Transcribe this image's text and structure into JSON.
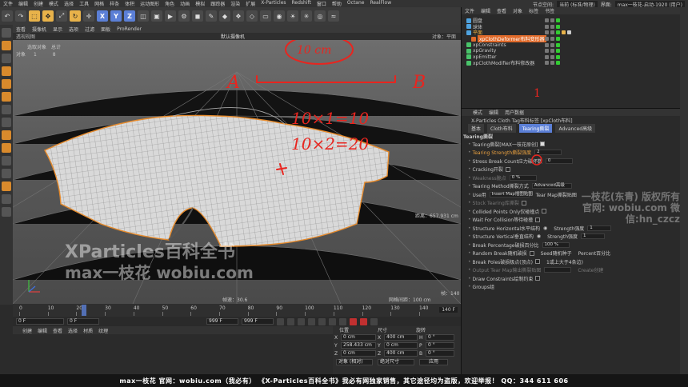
{
  "menubar": {
    "items": [
      "文件",
      "编辑",
      "创建",
      "模式",
      "选择",
      "工具",
      "网格",
      "样条",
      "体积",
      "运动图形",
      "角色",
      "动画",
      "模拟",
      "跟踪器",
      "渲染",
      "扩展",
      "X-Particles",
      "Redshift",
      "窗口",
      "帮助",
      "Octane",
      "RealFlow"
    ],
    "node_space_label": "节点空间:",
    "node_space_value": "当前 (标准/物理)",
    "layout_label": "界面:",
    "layout_value": "max一枝花-启动-1920 (用户)"
  },
  "viewport": {
    "menu": [
      "查看",
      "摄像机",
      "显示",
      "选项",
      "过滤",
      "面板",
      "ProRender"
    ],
    "title": "透视视图",
    "camera": "默认摄像机",
    "object_label": "对象：平面",
    "stats": {
      "header1": "选取对象",
      "header2": "总计",
      "row_label": "对象",
      "v1": "1",
      "v2": "8"
    },
    "distance": "距离：657.931 cm",
    "fps": "帧速：30.6",
    "grid": "网格间距：100 cm",
    "frame_counter": "帧：140"
  },
  "annotations": {
    "label_a": "A",
    "label_b": "B",
    "dimension": "10 cm",
    "eq1": "10×1=10",
    "eq2": "10×2=20",
    "number_one": "1"
  },
  "watermark": {
    "line1": "XParticles百科全书",
    "line2": "max一枝花 wobiu.com",
    "right1": "一枝花(东青) 版权所有",
    "right2": "官网: wobiu.com 微信:hn_czcz"
  },
  "timeline": {
    "ticks": [
      "0",
      "10",
      "20",
      "30",
      "40",
      "50",
      "60",
      "70",
      "80",
      "90",
      "100",
      "110",
      "120",
      "130",
      "140"
    ],
    "end_frame": "140 F",
    "start_field": "0 F",
    "cur_field": "0 F",
    "end_field": "999 F",
    "end_field2": "999 F"
  },
  "material_menu": [
    "创建",
    "编辑",
    "查看",
    "选择",
    "材质",
    "纹理"
  ],
  "coords": {
    "headers": [
      "位置",
      "尺寸",
      "旋转"
    ],
    "rows": [
      {
        "axis": "X",
        "pos": "0 cm",
        "size_axis": "X",
        "size": "400 cm",
        "rot_axis": "H",
        "rot": "0 °"
      },
      {
        "axis": "Y",
        "pos": "258.433 cm",
        "size_axis": "Y",
        "size": "0 cm",
        "rot_axis": "P",
        "rot": "0 °"
      },
      {
        "axis": "Z",
        "pos": "0 cm",
        "size_axis": "Z",
        "size": "400 cm",
        "rot_axis": "B",
        "rot": "0 °"
      }
    ],
    "mode1": "对象 (相对)",
    "mode2": "绝对尺寸",
    "apply": "应用"
  },
  "object_manager": {
    "tabs": [
      "文件",
      "编辑",
      "查看",
      "对象",
      "标签",
      "书签"
    ],
    "objects": [
      {
        "name": "圆盘",
        "color": "#4fa3e0",
        "indent": 0,
        "highlight": false
      },
      {
        "name": "球体",
        "color": "#4fa3e0",
        "indent": 0,
        "highlight": false
      },
      {
        "name": "平面",
        "color": "#4fa3e0",
        "indent": 0,
        "highlight": true
      },
      {
        "name": "xpClothDeformer布料变形器",
        "color": "#e06a2a",
        "indent": 6,
        "highlight": false
      },
      {
        "name": "xpConstraints",
        "color": "#49c46a",
        "indent": 0,
        "highlight": false
      },
      {
        "name": "xpGravity",
        "color": "#49c46a",
        "indent": 0,
        "highlight": false
      },
      {
        "name": "xpEmitter",
        "color": "#49c46a",
        "indent": 0,
        "highlight": false
      },
      {
        "name": "xpClothModifier布料修改器",
        "color": "#49c46a",
        "indent": 0,
        "highlight": false
      }
    ]
  },
  "attributes": {
    "menu": [
      "模式",
      "编辑",
      "用户数据"
    ],
    "title": "X-Particles Cloth Tag布料标签 [xpCloth布料]",
    "tabs": [
      "基本",
      "Cloth布料",
      "Tearing撕裂",
      "Advanced高级"
    ],
    "active_tab": "Tearing撕裂",
    "section": "Tearing撕裂",
    "rows": [
      {
        "label": "Tearing撕裂[MAX一枝花原创]",
        "type": "check",
        "on": true
      },
      {
        "label": "Tearing Strength撕裂强度",
        "type": "value",
        "value": "2",
        "orange": true
      },
      {
        "label": "Stress Break Count应力破坏数",
        "type": "value",
        "value": "0"
      },
      {
        "label": "Cracking开裂",
        "type": "check",
        "on": false
      },
      {
        "label": "Weakness脆点",
        "type": "value",
        "value": "0 %",
        "dim": true
      },
      {
        "label": "Tearing Method撕裂方式",
        "type": "value",
        "value": "Advanced高级"
      },
      {
        "label": "Use用",
        "type": "value",
        "value": "Insert Map插图贴图",
        "extra": "Tear Map撕裂贴图"
      },
      {
        "label": "Stock Tearing库撕裂",
        "type": "check",
        "on": false,
        "dim": true
      },
      {
        "label": "Collided Points Only仅碰撞点",
        "type": "check",
        "on": false
      },
      {
        "label": "Wait For Collision等待碰撞",
        "type": "check",
        "on": false
      },
      {
        "label": "Structure Horizontal水平结构",
        "type": "radio",
        "value": "1",
        "extra": "Strength强度"
      },
      {
        "label": "Structure Vertical垂直结构",
        "type": "radio",
        "value": "1",
        "extra": "Strength强度"
      },
      {
        "label": "Break Percentage破损百分比",
        "type": "value",
        "value": "100 %"
      },
      {
        "label": "Random Break随机破损",
        "type": "check",
        "on": false,
        "extra": "Seed随机种子",
        "extra2": "Percent百分比"
      },
      {
        "label": "Break Poles破损极点(顶点)",
        "type": "check",
        "on": false,
        "extra": "1或上大于4条边)"
      },
      {
        "label": "Output Tear Map输出撕裂贴图",
        "type": "value",
        "value": "",
        "dim": true,
        "extra": "Create创建"
      },
      {
        "label": "Draw Constraints绘制约束",
        "type": "check",
        "on": false
      },
      {
        "label": "Groups组",
        "type": "none"
      }
    ]
  },
  "footer": "max一枝花  官网：wobiu.com（我必有）  《X-Particles百科全书》我必有网独家销售，其它途径均为盗版，欢迎举报！  QQ：344 611 606",
  "colors": {
    "accent": "#e8b24a",
    "handwriting": "#e8251f",
    "selection": "#e06a2a"
  }
}
